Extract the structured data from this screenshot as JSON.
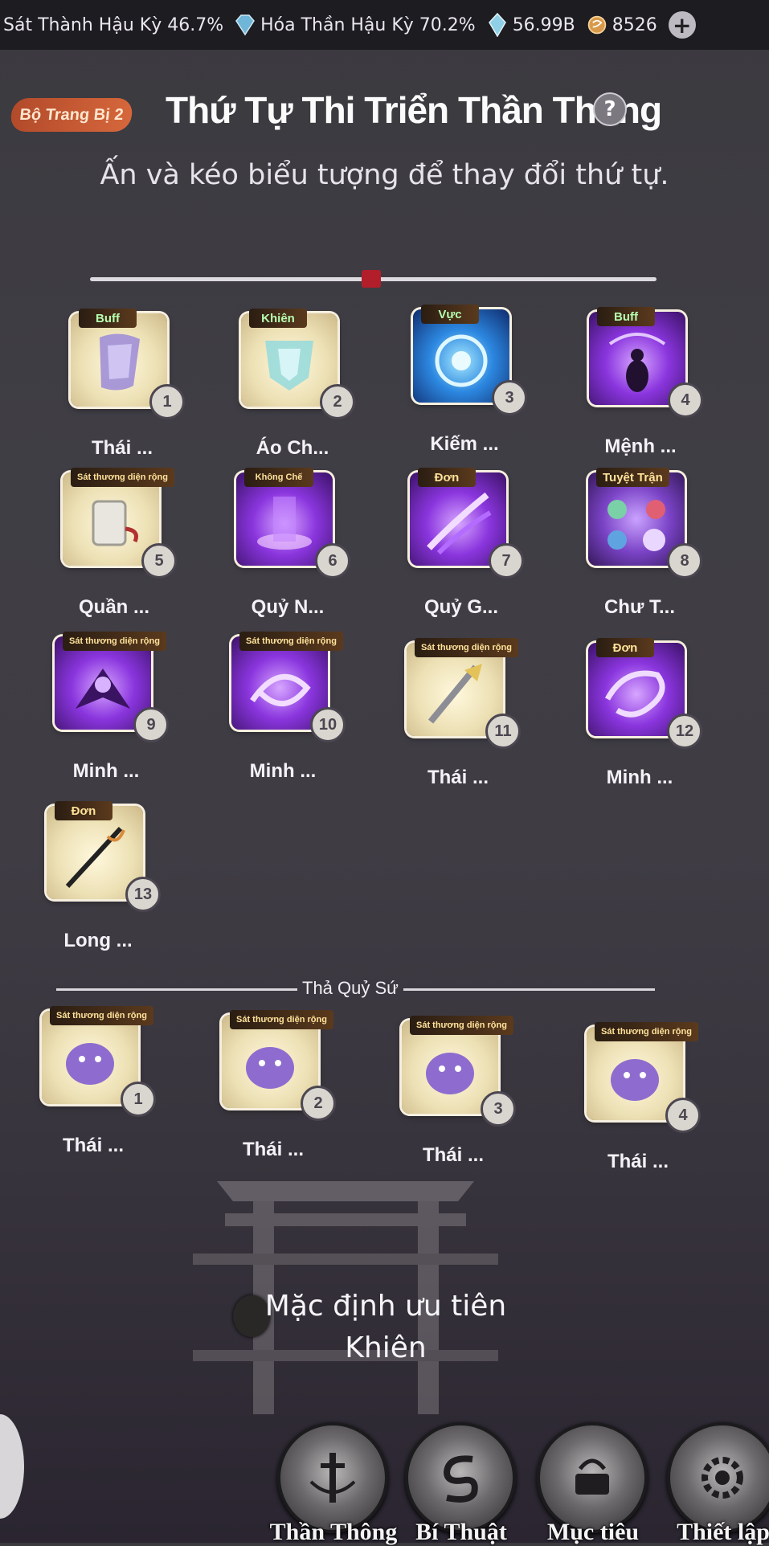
{
  "topbar": {
    "stat1": "Sát Thành Hậu Kỳ 46.7%",
    "stat2": "Hóa Thần Hậu Kỳ 70.2%",
    "stat3": "56.99B",
    "stat4": "8526",
    "plus": "+"
  },
  "header": {
    "set_label": "Bộ Trang Bị 2",
    "title": "Thứ Tự Thi Triển Thần Thông",
    "help": "?",
    "subtitle": "Ấn và kéo biểu tượng để thay đổi thứ tự."
  },
  "skills": [
    {
      "tag": "Buff",
      "num": "1",
      "name": "Thái ..."
    },
    {
      "tag": "Khiên",
      "num": "2",
      "name": "Áo Ch..."
    },
    {
      "tag": "Vực",
      "num": "3",
      "name": "Kiếm ..."
    },
    {
      "tag": "Buff",
      "num": "4",
      "name": "Mệnh ..."
    },
    {
      "tag": "Sát thương diện rộng",
      "num": "5",
      "name": "Quần ..."
    },
    {
      "tag": "Không Chế",
      "num": "6",
      "name": "Quỷ N..."
    },
    {
      "tag": "Đơn",
      "num": "7",
      "name": "Quỷ G..."
    },
    {
      "tag": "Tuyệt Trận",
      "num": "8",
      "name": "Chư T..."
    },
    {
      "tag": "Sát thương diện rộng",
      "num": "9",
      "name": "Minh ..."
    },
    {
      "tag": "Sát thương diện rộng",
      "num": "10",
      "name": "Minh ..."
    },
    {
      "tag": "Sát thương diện rộng",
      "num": "11",
      "name": "Thái ..."
    },
    {
      "tag": "Đơn",
      "num": "12",
      "name": "Minh ..."
    },
    {
      "tag": "Đơn",
      "num": "13",
      "name": "Long ..."
    }
  ],
  "summon_section": {
    "label": "Thả Quỷ Sứ",
    "items": [
      {
        "tag": "Sát thương diện rộng",
        "num": "1",
        "name": "Thái ..."
      },
      {
        "tag": "Sát thương diện rộng",
        "num": "2",
        "name": "Thái ..."
      },
      {
        "tag": "Sát thương diện rộng",
        "num": "3",
        "name": "Thái ..."
      },
      {
        "tag": "Sát thương diện rộng",
        "num": "4",
        "name": "Thái ..."
      }
    ]
  },
  "default_priority": {
    "line1": "Mặc định ưu tiên",
    "line2": "Khiên"
  },
  "bottom_nav": [
    {
      "label": "Thần Thông"
    },
    {
      "label": "Bí Thuật"
    },
    {
      "label": "Mục tiêu"
    },
    {
      "label": "Thiết lập"
    }
  ],
  "colors": {
    "accent_red": "#b21e2a",
    "badge_orange": "#d6673c",
    "tag_gold": "#ffe29a"
  }
}
